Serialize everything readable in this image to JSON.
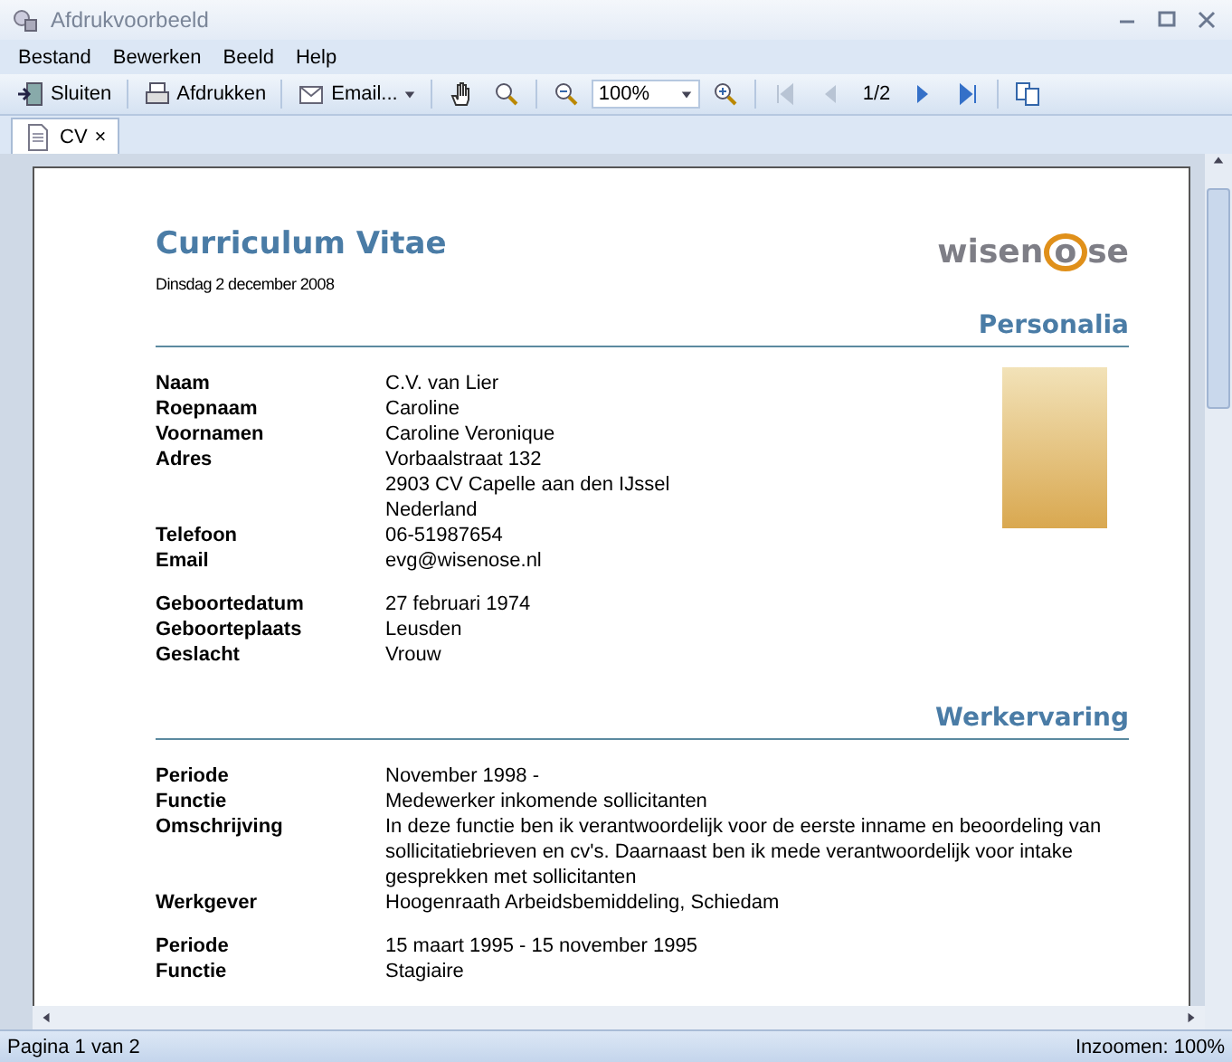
{
  "window": {
    "title": "Afdrukvoorbeeld"
  },
  "menu": [
    {
      "label": "Bestand"
    },
    {
      "label": "Bewerken"
    },
    {
      "label": "Beeld"
    },
    {
      "label": "Help"
    }
  ],
  "toolbar": [
    {
      "kind": "button",
      "label": "Sluiten"
    },
    {
      "kind": "sep"
    },
    {
      "kind": "button",
      "label": "Afdrukken"
    },
    {
      "kind": "sep"
    },
    {
      "kind": "dropdown-button",
      "label": "Email..."
    },
    {
      "kind": "sep"
    },
    {
      "kind": "icon"
    },
    {
      "kind": "icon"
    },
    {
      "kind": "sep"
    },
    {
      "kind": "icon"
    },
    {
      "kind": "combo",
      "value": "100%"
    },
    {
      "kind": "icon"
    },
    {
      "kind": "sep"
    },
    {
      "kind": "nav",
      "disabled": true
    },
    {
      "kind": "nav",
      "disabled": true
    },
    {
      "kind": "text",
      "label": "1/2"
    },
    {
      "kind": "nav",
      "disabled": false
    },
    {
      "kind": "nav",
      "disabled": false
    },
    {
      "kind": "sep"
    },
    {
      "kind": "icon"
    }
  ],
  "tabs": [
    {
      "label": "CV",
      "selected": true,
      "close": "×"
    }
  ],
  "document": {
    "title": "Curriculum Vitae",
    "date": "Dinsdag 2 december 2008",
    "logo": {
      "before": "wisen",
      "ring": "o",
      "after": "se"
    },
    "sections": [
      {
        "heading": "Personalia",
        "photo": true,
        "groups": [
          [
            {
              "label": "Naam",
              "lines": [
                "C.V. van Lier"
              ]
            },
            {
              "label": "Roepnaam",
              "lines": [
                "Caroline"
              ]
            },
            {
              "label": "Voornamen",
              "lines": [
                "Caroline Veronique"
              ]
            },
            {
              "label": "Adres",
              "lines": [
                "Vorbaalstraat 132",
                "2903 CV  Capelle aan den IJssel",
                "Nederland"
              ]
            },
            {
              "label": "Telefoon",
              "lines": [
                "06-51987654"
              ]
            },
            {
              "label": "Email",
              "lines": [
                "evg@wisenose.nl"
              ]
            }
          ],
          [
            {
              "label": "Geboortedatum",
              "lines": [
                "27 februari 1974"
              ]
            },
            {
              "label": "Geboorteplaats",
              "lines": [
                "Leusden"
              ]
            },
            {
              "label": "Geslacht",
              "lines": [
                "Vrouw"
              ]
            }
          ]
        ]
      },
      {
        "heading": "Werkervaring",
        "groups": [
          [
            {
              "label": "Periode",
              "lines": [
                "November 1998 -"
              ]
            },
            {
              "label": "Functie",
              "lines": [
                "Medewerker inkomende sollicitanten"
              ]
            },
            {
              "label": "Omschrijving",
              "lines": [
                "In deze functie ben ik verantwoordelijk voor de eerste inname en beoordeling van sollicitatiebrieven en cv's. Daarnaast ben ik mede verantwoordelijk voor intake gesprekken met sollicitanten"
              ]
            },
            {
              "label": "Werkgever",
              "lines": [
                "Hoogenraath Arbeidsbemiddeling, Schiedam"
              ]
            }
          ],
          [
            {
              "label": "Periode",
              "lines": [
                "15 maart 1995 - 15 november 1995"
              ]
            },
            {
              "label": "Functie",
              "lines": [
                "Stagiaire"
              ]
            }
          ]
        ]
      }
    ]
  },
  "status_bar": {
    "left": "Pagina 1 van 2",
    "right": "Inzoomen: 100%"
  }
}
